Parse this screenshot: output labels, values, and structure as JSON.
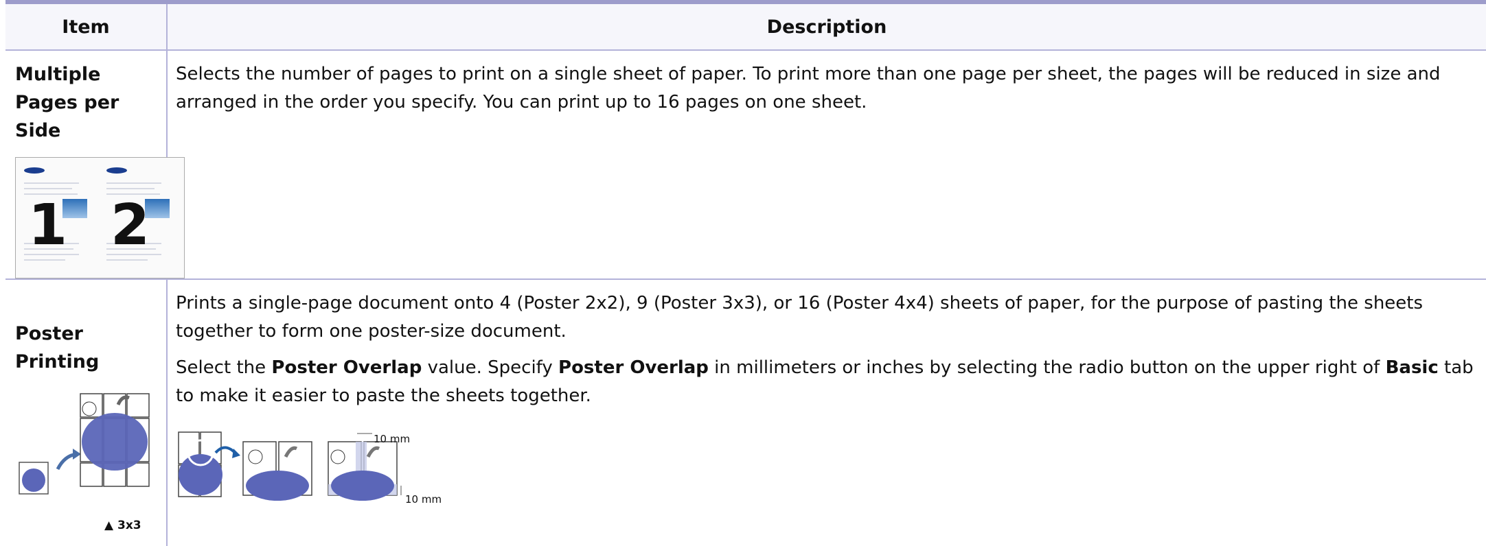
{
  "headers": {
    "item": "Item",
    "description": "Description"
  },
  "rows": [
    {
      "item": "Multiple Pages per Side",
      "description": "Selects the number of pages to print on a single sheet of paper. To print more than one page per sheet, the pages will be reduced in size and arranged in the order you specify. You can print up to 16 pages on one sheet.",
      "thumb_numbers": [
        "1",
        "2"
      ]
    },
    {
      "item": "Poster Printing",
      "description_p1": "Prints a single-page document onto 4 (Poster 2x2), 9 (Poster 3x3), or 16 (Poster 4x4) sheets of paper, for the purpose of pasting the sheets together to form one poster-size document.",
      "p2_pre": "Select the ",
      "p2_b1": "Poster Overlap",
      "p2_mid1": " value. Specify ",
      "p2_b2": "Poster Overlap",
      "p2_mid2": " in millimeters or inches by selecting the radio button on the upper right of ",
      "p2_b3": "Basic",
      "p2_post": " tab to make it easier to paste the sheets together.",
      "caption": "▲ 3x3",
      "overlap_label_top": "10 mm",
      "overlap_label_right": "10 mm"
    }
  ],
  "colors": {
    "rule": "#b3b2d9",
    "topline": "#9d9ccb",
    "apple": "#5b66b8"
  }
}
